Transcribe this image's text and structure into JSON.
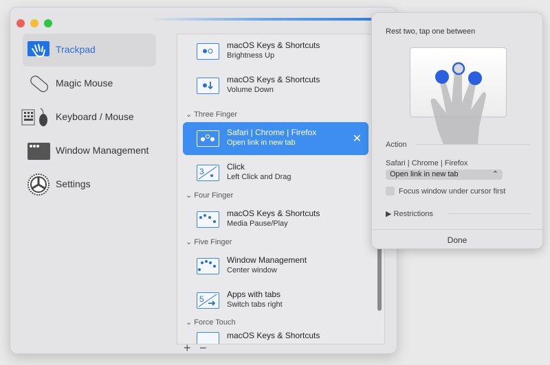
{
  "window": {
    "traffic_lights": {
      "close": "#ee5f57",
      "minimize": "#f6bd3b",
      "zoom": "#2fc645"
    }
  },
  "sidebar": {
    "items": [
      {
        "label": "Trackpad",
        "icon": "trackpad-hand-icon",
        "selected": true
      },
      {
        "label": "Magic Mouse",
        "icon": "magic-mouse-icon"
      },
      {
        "label": "Keyboard / Mouse",
        "icon": "keyboard-mouse-icon"
      },
      {
        "label": "Window Management",
        "icon": "window-icon"
      },
      {
        "label": "Settings",
        "icon": "gear-icon"
      }
    ]
  },
  "list": {
    "rows": [
      {
        "title": "macOS Keys & Shortcuts",
        "subtitle": "Brightness Up"
      },
      {
        "title": "macOS Keys & Shortcuts",
        "subtitle": "Volume Down"
      },
      {
        "title": "Safari | Chrome | Firefox",
        "subtitle": "Open link in new tab",
        "selected": true
      },
      {
        "title": "Click",
        "subtitle": "Left Click and Drag"
      },
      {
        "title": "macOS Keys & Shortcuts",
        "subtitle": "Media Pause/Play"
      },
      {
        "title": "Window Management",
        "subtitle": "Center window"
      },
      {
        "title": "Apps with tabs",
        "subtitle": "Switch tabs right"
      },
      {
        "title": "macOS Keys & Shortcuts",
        "subtitle": ""
      }
    ],
    "headers": [
      "Three Finger",
      "Four Finger",
      "Five Finger",
      "Force Touch"
    ],
    "add_label": "+",
    "remove_label": "−",
    "remove_row_label": "✕"
  },
  "popover": {
    "gesture_caption": "Rest two, tap one between",
    "action_header": "Action",
    "app_label": "Safari | Chrome | Firefox",
    "action_value": "Open link in new tab",
    "focus_checkbox_label": "Focus window under cursor first",
    "focus_checked": false,
    "restrictions_label": "Restrictions",
    "done_label": "Done"
  },
  "colors": {
    "accent": "#3d8ef0",
    "finger": "#2a5fe0"
  }
}
